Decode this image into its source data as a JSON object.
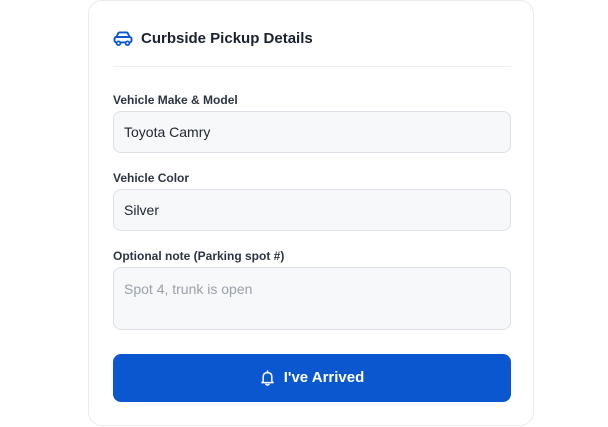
{
  "header": {
    "title": "Curbside Pickup Details",
    "icon": "car-icon"
  },
  "fields": {
    "vehicle_make_model": {
      "label": "Vehicle Make & Model",
      "value": "Toyota Camry"
    },
    "vehicle_color": {
      "label": "Vehicle Color",
      "value": "Silver"
    },
    "note": {
      "label": "Optional note (Parking spot #)",
      "value": "",
      "placeholder": "Spot 4, trunk is open"
    }
  },
  "submit": {
    "label": "I've Arrived",
    "icon": "bell-icon"
  },
  "colors": {
    "accent": "#0b57d0",
    "icon_blue": "#0b57d0",
    "input_bg": "#f7f8fa",
    "input_border": "#dde1e7",
    "card_border": "#e8ebf0"
  }
}
